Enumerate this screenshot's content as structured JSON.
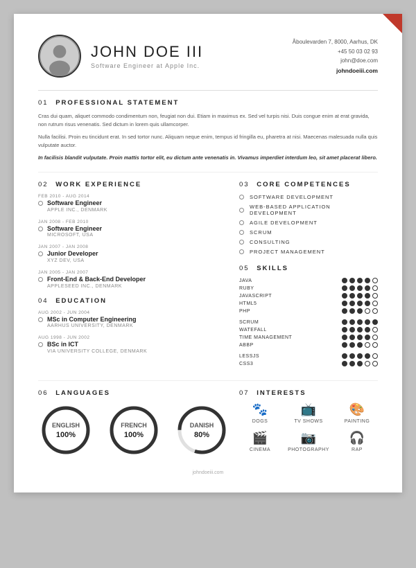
{
  "meta": {
    "footer_website": "johndoeiii.com"
  },
  "header": {
    "name": "JOHN DOE III",
    "subtitle": "Software Engineer at Apple Inc.",
    "address": "Åboulevarden 7, 8000, Aarhus, DK",
    "phone": "+45 50 03 02 93",
    "email": "john@doe.com",
    "website": "johndoeiii.com"
  },
  "sections": {
    "professional_statement": {
      "number": "01",
      "title": "PROFESSIONAL STATEMENT",
      "paragraph1": "Cras dui quam, aliquet commodo condimentum non, feugiat non dui. Etiam in maximus ex. Sed vel turpis nisi. Duis congue enim at erat gravida, non rutrum risus venenatis. Sed dictum in lorem quis ullamcorper.",
      "paragraph2": "Nulla facilisi. Proin eu tincidunt erat. In sed tortor nunc. Aliquam neque enim, tempus id fringilla eu, pharetra at nisi. Maecenas malesuada nulla quis vulputate auctor.",
      "paragraph3": "In facilisis blandit vulputate. Proin mattis tortor elit, eu dictum ante venenatis in. Vivamus imperdiet interdum leo, sit amet placerat libero."
    },
    "work_experience": {
      "number": "02",
      "title": "WORK EXPERIENCE",
      "items": [
        {
          "date": "FEB 2010 - AUG 2014",
          "title": "Software Engineer",
          "company": "APPLE INC., DENMARK"
        },
        {
          "date": "JAN 2008 - FEB 2010",
          "title": "Software Engineer",
          "company": "MICROSOFT, USA"
        },
        {
          "date": "JAN 2007 - JAN 2008",
          "title": "Junior Developer",
          "company": "XYZ DEV, USA"
        },
        {
          "date": "JAN 2005 - JAN 2007",
          "title": "Front-End & Back-End Developer",
          "company": "APPLESEED INC., DENMARK"
        }
      ]
    },
    "education": {
      "number": "04",
      "title": "EDUCATION",
      "items": [
        {
          "date": "AUG 2002 - JUN 2004",
          "title": "MSc in Computer Engineering",
          "company": "AARHUS UNIVERSITY, DENMARK"
        },
        {
          "date": "AUG 1998 - JUN 2002",
          "title": "BSc in ICT",
          "company": "VIA UNIVERSITY COLLEGE, DENMARK"
        }
      ]
    },
    "core_competences": {
      "number": "03",
      "title": "CORE COMPETENCES",
      "items": [
        "SOFTWARE DEVELOPMENT",
        "WEB-BASED APPLICATION DEVELOPMENT",
        "AGILE DEVELOPMENT",
        "SCRUM",
        "CONSULTING",
        "PROJECT MANAGEMENT"
      ]
    },
    "skills": {
      "number": "05",
      "title": "SKILLS",
      "groups": [
        {
          "items": [
            {
              "name": "JAVA",
              "filled": 4,
              "empty": 1
            },
            {
              "name": "RUBY",
              "filled": 4,
              "empty": 1
            },
            {
              "name": "JAVASCRIPT",
              "filled": 4,
              "empty": 1
            },
            {
              "name": "HTML5",
              "filled": 4,
              "empty": 1
            },
            {
              "name": "PHP",
              "filled": 3,
              "empty": 2
            }
          ]
        },
        {
          "items": [
            {
              "name": "SCRUM",
              "filled": 5,
              "empty": 0
            },
            {
              "name": "WATEFALL",
              "filled": 4,
              "empty": 1
            },
            {
              "name": "TIME MANAGEMENT",
              "filled": 4,
              "empty": 1
            },
            {
              "name": "ABBP",
              "filled": 3,
              "empty": 2
            }
          ]
        },
        {
          "items": [
            {
              "name": "LESSJS",
              "filled": 4,
              "empty": 1
            },
            {
              "name": "CSS3",
              "filled": 3,
              "empty": 2
            }
          ]
        }
      ]
    },
    "languages": {
      "number": "06",
      "title": "LANGUAGES",
      "items": [
        {
          "name": "ENGLISH",
          "percent": "100%",
          "value": 100
        },
        {
          "name": "FRENCH",
          "percent": "100%",
          "value": 100
        },
        {
          "name": "DANISH",
          "percent": "80%",
          "value": 80
        }
      ]
    },
    "interests": {
      "number": "07",
      "title": "INTERESTS",
      "items": [
        {
          "icon": "🐾",
          "label": "DOGS"
        },
        {
          "icon": "📺",
          "label": "TV SHOWS"
        },
        {
          "icon": "🎨",
          "label": "PAINTING"
        },
        {
          "icon": "🎬",
          "label": "CINEMA"
        },
        {
          "icon": "📷",
          "label": "PHOTOGRAPHY"
        },
        {
          "icon": "🎧",
          "label": "RAP"
        }
      ]
    }
  }
}
